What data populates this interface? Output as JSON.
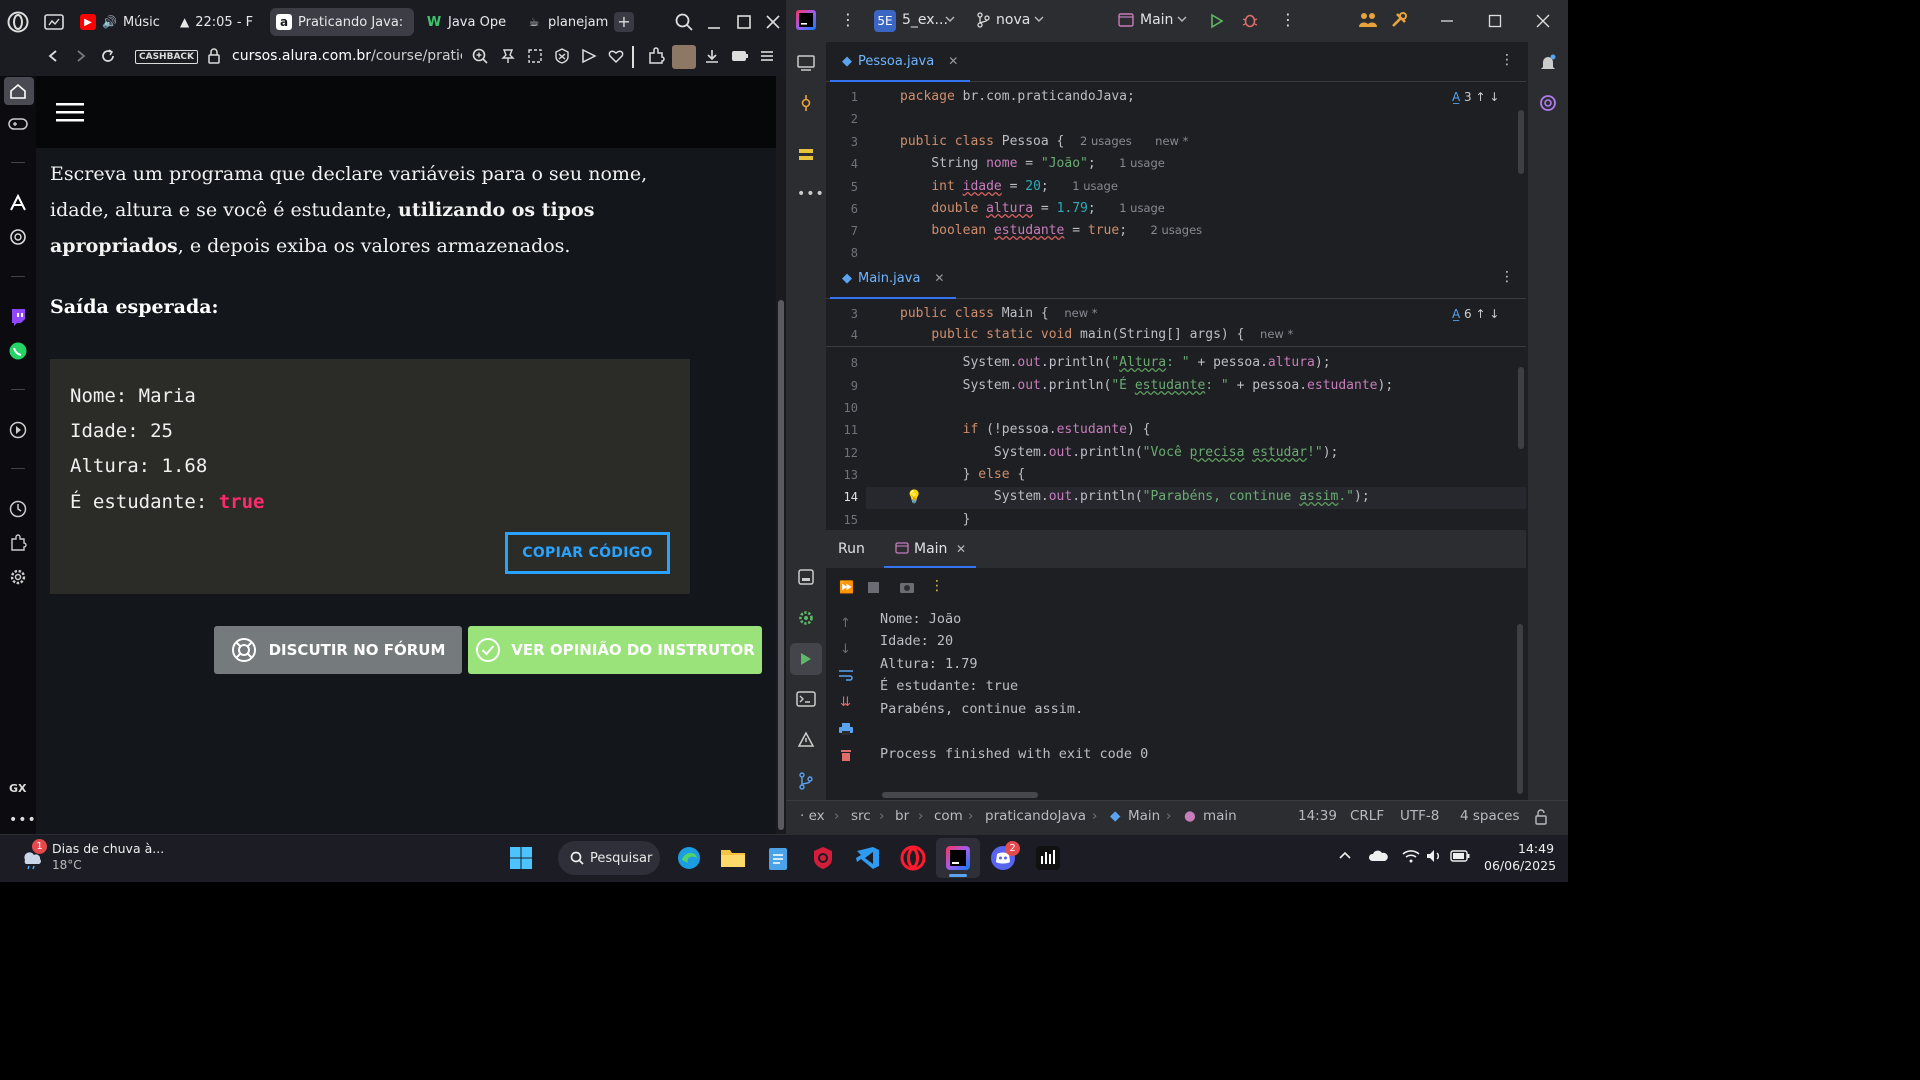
{
  "browser": {
    "tabs": [
      {
        "label": "Músic",
        "icon": "youtube-music-icon"
      },
      {
        "label": "22:05 - F",
        "icon": "triangle-icon"
      },
      {
        "label": "Praticando Java:",
        "icon": "alura-icon",
        "active": true
      },
      {
        "label": "Java Ope",
        "icon": "w-icon"
      },
      {
        "label": "planejam",
        "icon": "cup-icon"
      }
    ],
    "cashback": "CASHBACK",
    "url_host": "cursos.alura.com.br",
    "url_path": "/course/pratican",
    "side_label": "GX"
  },
  "page": {
    "exercise_part1": "Escreva um programa que declare variáveis para o seu nome, idade, altura e se você é estudante, ",
    "exercise_bold": "utilizando os tipos apropriados",
    "exercise_part2": ", e depois exiba os valores armazenados.",
    "expected_title": "Saída esperada:",
    "expected_lines": [
      "Nome: Maria",
      "Idade: 25",
      "Altura: 1.68",
      "É estudante: "
    ],
    "expected_true": "true",
    "copy_button": "COPIAR CÓDIGO",
    "forum_button": "DISCUTIR NO FÓRUM",
    "opinion_button": "VER OPINIÃO DO INSTRUTOR"
  },
  "ide": {
    "project_badge": "5E",
    "project_name": "5_ex...",
    "branch": "nova",
    "run_config": "Main",
    "tab1": "Pessoa.java",
    "tab2": "Main.java",
    "pessoa_problems": "3",
    "main_problems": "6",
    "run_label": "Run",
    "run_tab": "Main",
    "hints": {
      "usages2": "2 usages",
      "new": "new *",
      "usage1": "1 usage"
    },
    "output": [
      "Nome: João",
      "Idade: 20",
      "Altura: 1.79",
      "É estudante: true",
      "Parabéns, continue assim.",
      "",
      "Process finished with exit code 0"
    ],
    "breadcrumb": [
      "ex",
      "src",
      "br",
      "com",
      "praticandoJava",
      "Main",
      "main"
    ],
    "status": {
      "position": "14:39",
      "line_sep": "CRLF",
      "encoding": "UTF-8",
      "indent": "4 spaces"
    }
  },
  "taskbar": {
    "weather_title": "Dias de chuva à...",
    "weather_temp": "18°C",
    "weather_badge": "1",
    "search": "Pesquisar",
    "discord_badge": "2",
    "time": "14:49",
    "date": "06/06/2025"
  }
}
